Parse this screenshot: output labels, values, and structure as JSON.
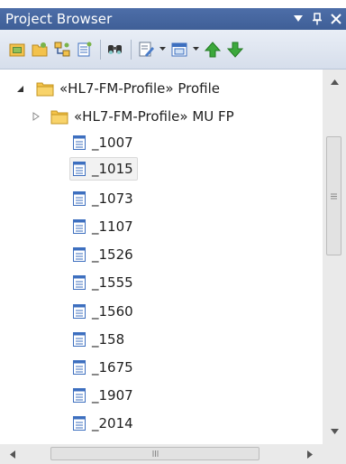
{
  "panel": {
    "title": "Project Browser",
    "controls": [
      {
        "name": "dropdown-icon",
        "glyph": "▼"
      },
      {
        "name": "pin-icon",
        "glyph": "⊥"
      },
      {
        "name": "close-icon",
        "glyph": "✕"
      }
    ]
  },
  "toolbar": {
    "buttons": [
      "new-model-icon",
      "new-package-icon",
      "new-diagram-icon",
      "new-element-icon",
      "find-icon",
      "edit-properties-icon",
      "view-options-icon",
      "move-up-icon",
      "move-down-icon"
    ]
  },
  "tree": {
    "root": {
      "label": "«HL7-FM-Profile» Profile",
      "expanded": true
    },
    "child_package": {
      "label": "«HL7-FM-Profile» MU FP",
      "expanded": false
    },
    "items": [
      "_1007",
      "_1015",
      "_1073",
      "_1107",
      "_1526",
      "_1555",
      "_1560",
      "_158",
      "_1675",
      "_1907",
      "_2014"
    ],
    "selected_index": 1
  },
  "colors": {
    "title_bar": "#4669a4",
    "folder": "#f5c44a",
    "doc_icon": "#3d6fbf",
    "selection": "#f2f2f2"
  }
}
